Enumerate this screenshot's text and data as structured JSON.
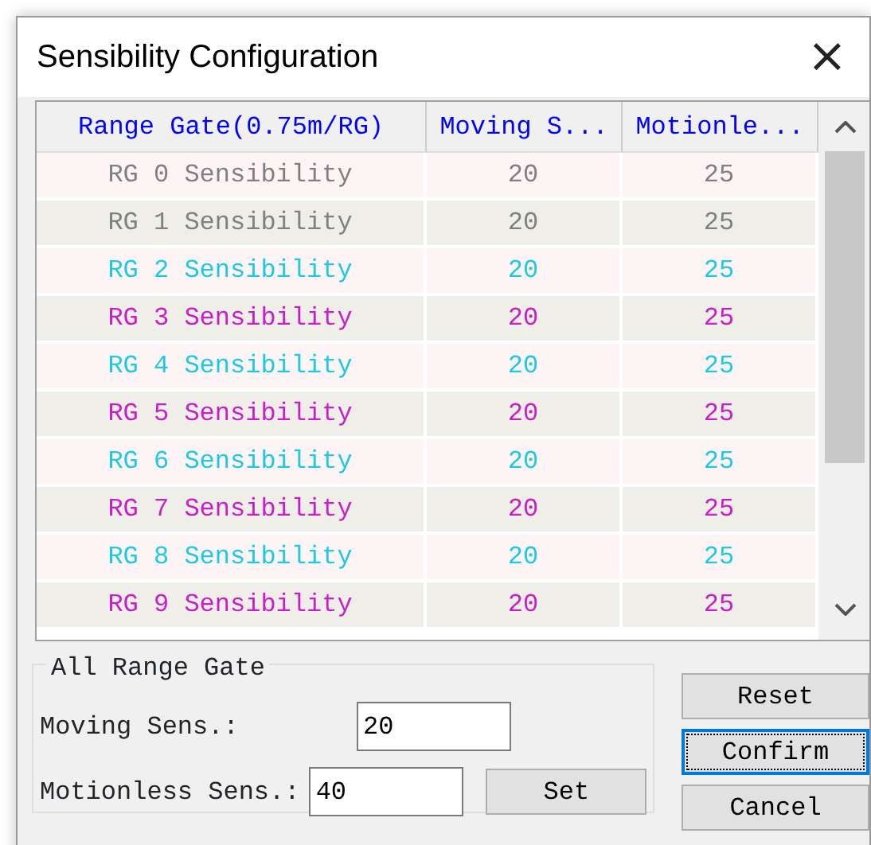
{
  "window": {
    "title": "Sensibility Configuration",
    "close": "×"
  },
  "table": {
    "columns": [
      "Range Gate(0.75m/RG)",
      "Moving S...",
      "Motionle..."
    ],
    "rows": [
      {
        "gate": "RG 0 Sensibility",
        "moving": "20",
        "motionless": "25",
        "color": "#808080"
      },
      {
        "gate": "RG 1 Sensibility",
        "moving": "20",
        "motionless": "25",
        "color": "#808080"
      },
      {
        "gate": "RG 2 Sensibility",
        "moving": "20",
        "motionless": "25",
        "color": "#1ec8e6"
      },
      {
        "gate": "RG 3 Sensibility",
        "moving": "20",
        "motionless": "25",
        "color": "#c81ec8"
      },
      {
        "gate": "RG 4 Sensibility",
        "moving": "20",
        "motionless": "25",
        "color": "#1ec8e6"
      },
      {
        "gate": "RG 5 Sensibility",
        "moving": "20",
        "motionless": "25",
        "color": "#c81ec8"
      },
      {
        "gate": "RG 6 Sensibility",
        "moving": "20",
        "motionless": "25",
        "color": "#1ec8e6"
      },
      {
        "gate": "RG 7 Sensibility",
        "moving": "20",
        "motionless": "25",
        "color": "#c81ec8"
      },
      {
        "gate": "RG 8 Sensibility",
        "moving": "20",
        "motionless": "25",
        "color": "#1ec8e6"
      },
      {
        "gate": "RG 9 Sensibility",
        "moving": "20",
        "motionless": "25",
        "color": "#c81ec8"
      }
    ]
  },
  "all_range_gate": {
    "title": "All Range Gate",
    "fields": [
      {
        "label": "Moving Sens.:",
        "value": "20"
      },
      {
        "label": "Motionless Sens.:",
        "value": "40"
      }
    ],
    "set_button": "Set"
  },
  "buttons": [
    {
      "label": "Reset",
      "default": false
    },
    {
      "label": "Confirm",
      "default": true
    },
    {
      "label": "Cancel",
      "default": false
    }
  ]
}
